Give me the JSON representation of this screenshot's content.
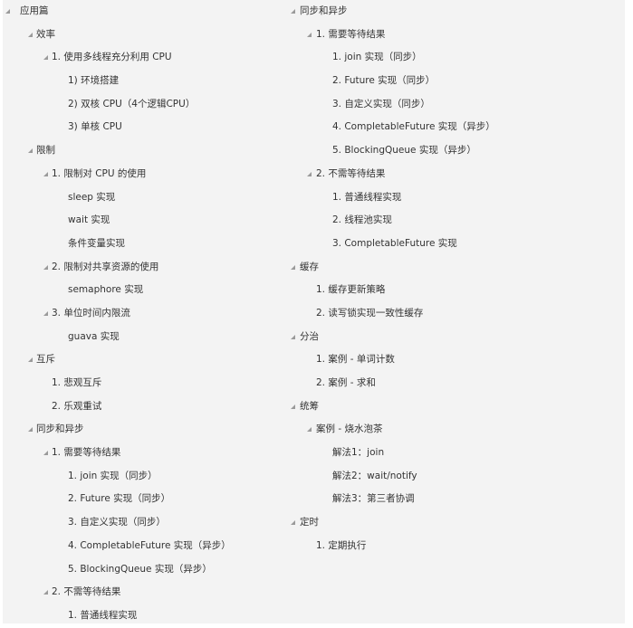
{
  "expand_icon": "expanded-triangle-icon",
  "left_column": [
    {
      "level": 0,
      "expanded": true,
      "label": "应用篇"
    },
    {
      "level": 1,
      "expanded": true,
      "label": "效率"
    },
    {
      "level": 2,
      "expanded": true,
      "label": "1. 使用多线程充分利用 CPU"
    },
    {
      "level": 3,
      "expanded": false,
      "label": "1) 环境搭建"
    },
    {
      "level": 3,
      "expanded": false,
      "label": "2) 双核 CPU（4个逻辑CPU）"
    },
    {
      "level": 3,
      "expanded": false,
      "label": "3) 单核 CPU"
    },
    {
      "level": 1,
      "expanded": true,
      "label": "限制"
    },
    {
      "level": 2,
      "expanded": true,
      "label": "1. 限制对 CPU 的使用"
    },
    {
      "level": 3,
      "expanded": false,
      "label": "sleep 实现"
    },
    {
      "level": 3,
      "expanded": false,
      "label": "wait 实现"
    },
    {
      "level": 3,
      "expanded": false,
      "label": "条件变量实现"
    },
    {
      "level": 2,
      "expanded": true,
      "label": "2. 限制对共享资源的使用"
    },
    {
      "level": 3,
      "expanded": false,
      "label": "semaphore 实现"
    },
    {
      "level": 2,
      "expanded": true,
      "label": "3. 单位时间内限流"
    },
    {
      "level": 3,
      "expanded": false,
      "label": "guava 实现"
    },
    {
      "level": 1,
      "expanded": true,
      "label": "互斥"
    },
    {
      "level": 2,
      "expanded": false,
      "label": "1. 悲观互斥"
    },
    {
      "level": 2,
      "expanded": false,
      "label": "2. 乐观重试"
    },
    {
      "level": 1,
      "expanded": true,
      "label": "同步和异步"
    },
    {
      "level": 2,
      "expanded": true,
      "label": "1. 需要等待结果"
    },
    {
      "level": 3,
      "expanded": false,
      "label": "1. join 实现（同步）"
    },
    {
      "level": 3,
      "expanded": false,
      "label": "2. Future 实现（同步）"
    },
    {
      "level": 3,
      "expanded": false,
      "label": "3. 自定义实现（同步）"
    },
    {
      "level": 3,
      "expanded": false,
      "label": "4. CompletableFuture 实现（异步）"
    },
    {
      "level": 3,
      "expanded": false,
      "label": "5. BlockingQueue 实现（异步）"
    },
    {
      "level": 2,
      "expanded": true,
      "label": "2. 不需等待结果"
    },
    {
      "level": 3,
      "expanded": false,
      "label": "1. 普通线程实现"
    }
  ],
  "right_column": [
    {
      "level": 0,
      "expanded": true,
      "label": "同步和异步"
    },
    {
      "level": 1,
      "expanded": true,
      "label": "1. 需要等待结果"
    },
    {
      "level": 2,
      "expanded": false,
      "label": "1. join 实现（同步）"
    },
    {
      "level": 2,
      "expanded": false,
      "label": "2. Future 实现（同步）"
    },
    {
      "level": 2,
      "expanded": false,
      "label": "3. 自定义实现（同步）"
    },
    {
      "level": 2,
      "expanded": false,
      "label": "4. CompletableFuture 实现（异步）"
    },
    {
      "level": 2,
      "expanded": false,
      "label": "5. BlockingQueue 实现（异步）"
    },
    {
      "level": 1,
      "expanded": true,
      "label": "2. 不需等待结果"
    },
    {
      "level": 2,
      "expanded": false,
      "label": "1. 普通线程实现"
    },
    {
      "level": 2,
      "expanded": false,
      "label": "2. 线程池实现"
    },
    {
      "level": 2,
      "expanded": false,
      "label": "3. CompletableFuture 实现"
    },
    {
      "level": 0,
      "expanded": true,
      "label": "缓存"
    },
    {
      "level": 1,
      "expanded": false,
      "label": "1. 缓存更新策略"
    },
    {
      "level": 1,
      "expanded": false,
      "label": "2. 读写锁实现一致性缓存"
    },
    {
      "level": 0,
      "expanded": true,
      "label": "分治"
    },
    {
      "level": 1,
      "expanded": false,
      "label": "1. 案例 - 单词计数"
    },
    {
      "level": 1,
      "expanded": false,
      "label": "2. 案例 - 求和"
    },
    {
      "level": 0,
      "expanded": true,
      "label": "统筹"
    },
    {
      "level": 1,
      "expanded": true,
      "label": "案例 - 烧水泡茶"
    },
    {
      "level": 2,
      "expanded": false,
      "label": "解法1：join"
    },
    {
      "level": 2,
      "expanded": false,
      "label": "解法2：wait/notify"
    },
    {
      "level": 2,
      "expanded": false,
      "label": "解法3：第三者协调"
    },
    {
      "level": 0,
      "expanded": true,
      "label": "定时"
    },
    {
      "level": 1,
      "expanded": false,
      "label": "1. 定期执行"
    }
  ]
}
